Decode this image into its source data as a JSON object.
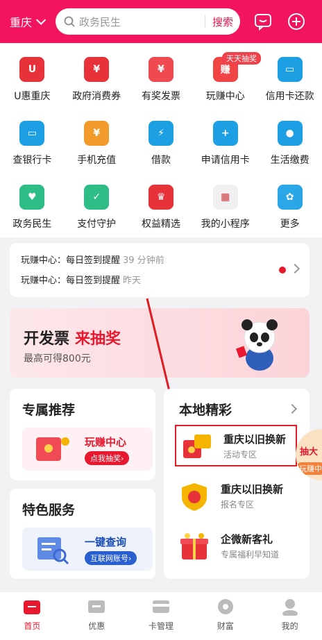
{
  "header": {
    "city": "重庆",
    "search_placeholder": "政务民生",
    "search_button": "搜索"
  },
  "grid": [
    {
      "label": "U惠重庆",
      "icon": "u-coupon-icon",
      "color": "#e8323a",
      "glyph": "U"
    },
    {
      "label": "政府消费券",
      "icon": "voucher-icon",
      "color": "#e8323a",
      "glyph": "¥"
    },
    {
      "label": "有奖发票",
      "icon": "invoice-gift-icon",
      "color": "#ef4a4f",
      "glyph": "¥"
    },
    {
      "label": "玩赚中心",
      "icon": "earn-center-icon",
      "color": "#f14545",
      "glyph": "赚"
    },
    {
      "label": "信用卡还款",
      "icon": "credit-card-repay-icon",
      "color": "#1d9fe3",
      "glyph": "▭"
    },
    {
      "label": "查银行卡",
      "icon": "bank-card-icon",
      "color": "#1d9fe3",
      "glyph": "▭"
    },
    {
      "label": "手机充值",
      "icon": "phone-recharge-icon",
      "color": "#f29b2b",
      "glyph": "¥"
    },
    {
      "label": "借款",
      "icon": "loan-icon",
      "color": "#1d9fe3",
      "glyph": "⚡"
    },
    {
      "label": "申请信用卡",
      "icon": "apply-card-icon",
      "color": "#1d9fe3",
      "glyph": "+"
    },
    {
      "label": "生活缴费",
      "icon": "life-payment-icon",
      "color": "#1d9fe3",
      "glyph": "●"
    },
    {
      "label": "政务民生",
      "icon": "gov-home-icon",
      "color": "#2ebd86",
      "glyph": "♥"
    },
    {
      "label": "支付守护",
      "icon": "shield-check-icon",
      "color": "#2ebd86",
      "glyph": "✓"
    },
    {
      "label": "权益精选",
      "icon": "crown-icon",
      "color": "#e8323a",
      "glyph": "♛"
    },
    {
      "label": "我的小程序",
      "icon": "mini-program-icon",
      "color": "#f0f0f0",
      "glyph": "▦"
    },
    {
      "label": "更多",
      "icon": "more-clover-icon",
      "color": "#28a6e6",
      "glyph": "✿"
    }
  ],
  "grid_badge": "天天抽奖",
  "notice": {
    "rows": [
      {
        "text": "玩赚中心：每日签到提醒",
        "time": "39 分钟前"
      },
      {
        "text": "玩赚中心：每日签到提醒",
        "time": "昨天"
      }
    ]
  },
  "banner": {
    "title_a": "开发票",
    "title_b": "来抽奖",
    "subtitle": "最高可得800元"
  },
  "recommend": {
    "title": "专属推荐",
    "item_title": "玩赚中心",
    "item_pill": "点我抽奖›"
  },
  "services": {
    "title": "特色服务",
    "item_title": "一键查询",
    "item_pill": "互联网账号›"
  },
  "local": {
    "title": "本地精彩",
    "items": [
      {
        "name": "重庆以旧换新",
        "desc": "活动专区"
      },
      {
        "name": "重庆以旧换新",
        "desc": "报名专区"
      },
      {
        "name": "企微新客礼",
        "desc": "专属福利早知道"
      }
    ],
    "float_badge_top": "抽大",
    "float_badge_bottom": "玩赚中"
  },
  "tabs": [
    {
      "label": "首页",
      "active": true
    },
    {
      "label": "优惠",
      "active": false
    },
    {
      "label": "卡管理",
      "active": false
    },
    {
      "label": "财富",
      "active": false
    },
    {
      "label": "我的",
      "active": false
    }
  ],
  "colors": {
    "brand": "#f2145f",
    "accent_red": "#e8192f",
    "annotation": "#e01b24"
  }
}
